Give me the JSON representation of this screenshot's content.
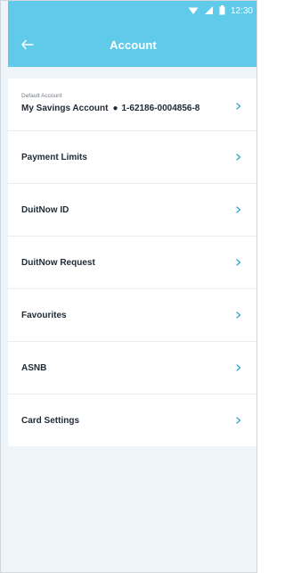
{
  "status_bar": {
    "time": "12:30",
    "icons": [
      "wifi-icon",
      "signal-icon",
      "battery-icon"
    ]
  },
  "header": {
    "title": "Account",
    "back_icon": "back-arrow-icon"
  },
  "default_account": {
    "label": "Default Account",
    "name": "My Savings Account",
    "separator": "●",
    "number": "1-62186-0004856-8"
  },
  "menu": {
    "items": [
      {
        "label": "Payment Limits"
      },
      {
        "label": "DuitNow ID"
      },
      {
        "label": "DuitNow Request"
      },
      {
        "label": "Favourites"
      },
      {
        "label": "ASNB"
      },
      {
        "label": "Card Settings"
      }
    ]
  },
  "colors": {
    "header_bg": "#5fcaea",
    "page_bg": "#edf5fa",
    "list_bg": "#ffffff",
    "text_primary": "#1e2a36",
    "chevron": "#2a9fd6"
  }
}
